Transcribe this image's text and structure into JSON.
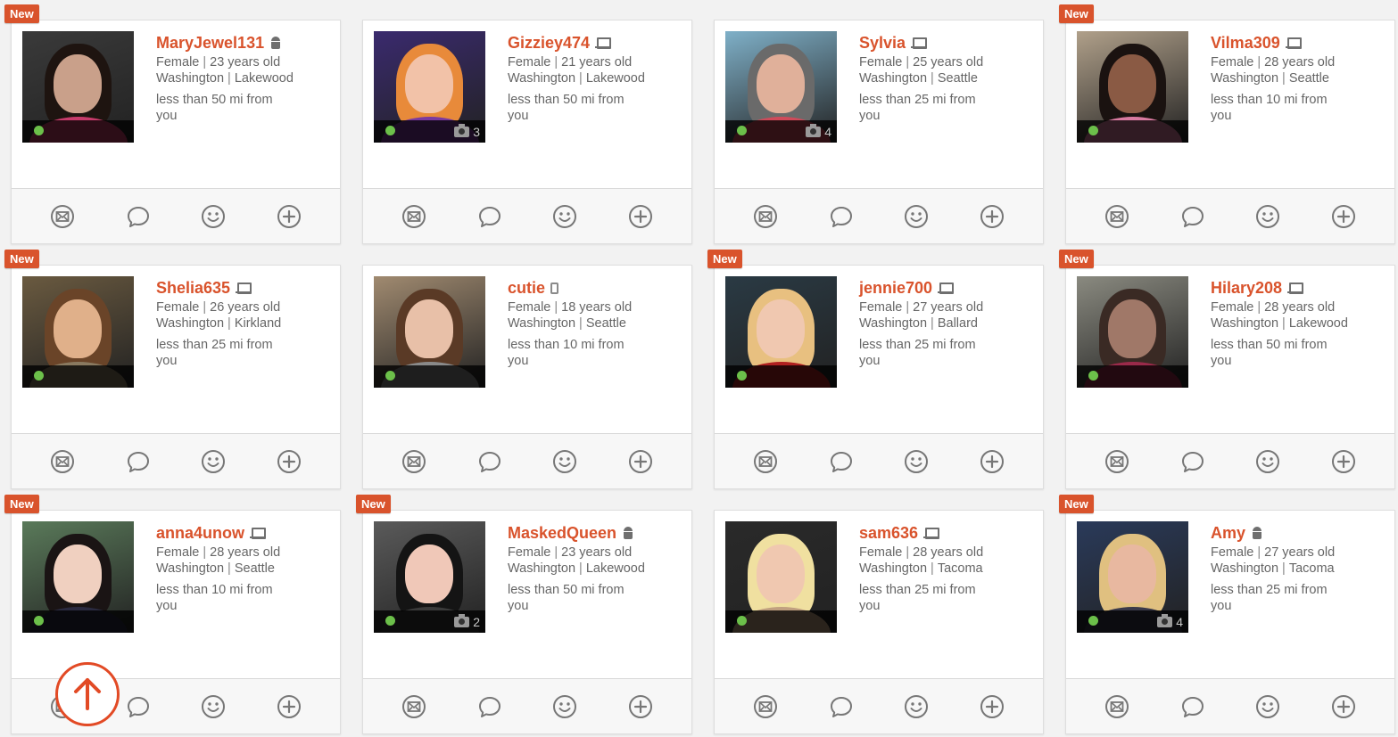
{
  "badge_label": "New",
  "colors": {
    "accent": "#d9532c",
    "online": "#6cc04a"
  },
  "icons": {
    "message": "envelope-icon",
    "chat": "chat-bubble-icon",
    "wink": "smiley-icon",
    "favorite": "plus-circle-icon",
    "scroll_top": "arrow-up-icon"
  },
  "profiles": [
    {
      "name": "MaryJewel131",
      "device": "android",
      "gender": "Female",
      "age": "23 years old",
      "state": "Washington",
      "city": "Lakewood",
      "distance": "less than 50 mi from",
      "distance_suffix": "you",
      "is_new": true,
      "online": true,
      "photo_count": ""
    },
    {
      "name": "Gizziey474",
      "device": "laptop",
      "gender": "Female",
      "age": "21 years old",
      "state": "Washington",
      "city": "Lakewood",
      "distance": "less than 50 mi from",
      "distance_suffix": "you",
      "is_new": false,
      "online": true,
      "photo_count": "3"
    },
    {
      "name": "Sylvia",
      "device": "laptop",
      "gender": "Female",
      "age": "25 years old",
      "state": "Washington",
      "city": "Seattle",
      "distance": "less than 25 mi from",
      "distance_suffix": "you",
      "is_new": false,
      "online": true,
      "photo_count": "4"
    },
    {
      "name": "Vilma309",
      "device": "laptop",
      "gender": "Female",
      "age": "28 years old",
      "state": "Washington",
      "city": "Seattle",
      "distance": "less than 10 mi from",
      "distance_suffix": "you",
      "is_new": true,
      "online": true,
      "photo_count": ""
    },
    {
      "name": "Shelia635",
      "device": "laptop",
      "gender": "Female",
      "age": "26 years old",
      "state": "Washington",
      "city": "Kirkland",
      "distance": "less than 25 mi from",
      "distance_suffix": "you",
      "is_new": true,
      "online": true,
      "photo_count": ""
    },
    {
      "name": "cutie",
      "device": "phone",
      "gender": "Female",
      "age": "18 years old",
      "state": "Washington",
      "city": "Seattle",
      "distance": "less than 10 mi from",
      "distance_suffix": "you",
      "is_new": false,
      "online": true,
      "photo_count": ""
    },
    {
      "name": "jennie700",
      "device": "laptop",
      "gender": "Female",
      "age": "27 years old",
      "state": "Washington",
      "city": "Ballard",
      "distance": "less than 25 mi from",
      "distance_suffix": "you",
      "is_new": true,
      "online": true,
      "photo_count": ""
    },
    {
      "name": "Hilary208",
      "device": "laptop",
      "gender": "Female",
      "age": "28 years old",
      "state": "Washington",
      "city": "Lakewood",
      "distance": "less than 50 mi from",
      "distance_suffix": "you",
      "is_new": true,
      "online": true,
      "photo_count": ""
    },
    {
      "name": "anna4unow",
      "device": "laptop",
      "gender": "Female",
      "age": "28 years old",
      "state": "Washington",
      "city": "Seattle",
      "distance": "less than 10 mi from",
      "distance_suffix": "you",
      "is_new": true,
      "online": true,
      "photo_count": ""
    },
    {
      "name": "MaskedQueen",
      "device": "android",
      "gender": "Female",
      "age": "23 years old",
      "state": "Washington",
      "city": "Lakewood",
      "distance": "less than 50 mi from",
      "distance_suffix": "you",
      "is_new": true,
      "online": true,
      "photo_count": "2"
    },
    {
      "name": "sam636",
      "device": "laptop",
      "gender": "Female",
      "age": "28 years old",
      "state": "Washington",
      "city": "Tacoma",
      "distance": "less than 25 mi from",
      "distance_suffix": "you",
      "is_new": false,
      "online": true,
      "photo_count": ""
    },
    {
      "name": "Amy",
      "device": "android",
      "gender": "Female",
      "age": "27 years old",
      "state": "Washington",
      "city": "Tacoma",
      "distance": "less than 25 mi from",
      "distance_suffix": "you",
      "is_new": true,
      "online": true,
      "photo_count": "4"
    }
  ]
}
